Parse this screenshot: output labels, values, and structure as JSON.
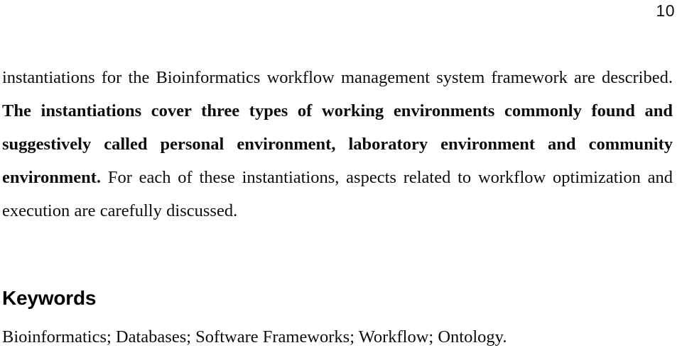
{
  "document": {
    "page_number": "10",
    "abstract": {
      "lead_sentence": "The instantiations cover three types of working environments commonly found and suggestively called personal environment, laboratory environment and community environment.",
      "text_before_lead": "instantiations for the Bioinformatics workflow management system framework are described.",
      "text_after_lead": "For each of these instantiations, aspects related to workflow optimization and execution are carefully discussed.",
      "full_text": "instantiations for the Bioinformatics workflow management system framework are described. The instantiations cover three types of working environments commonly found and suggestively called personal environment, laboratory environment and community environment. For each of these instantiations, aspects related to workflow optimization and execution are carefully discussed."
    },
    "keywords_section": {
      "heading": "Keywords",
      "terms_line": "Bioinformatics; Databases; Software Frameworks; Workflow; Ontology.",
      "terms": [
        "Bioinformatics",
        "Databases",
        "Software Frameworks",
        "Workflow",
        "Ontology"
      ]
    }
  },
  "colors": {
    "page_background": "#ffffff",
    "body_text": "#0d0d0d",
    "heading_text": "#000000"
  }
}
